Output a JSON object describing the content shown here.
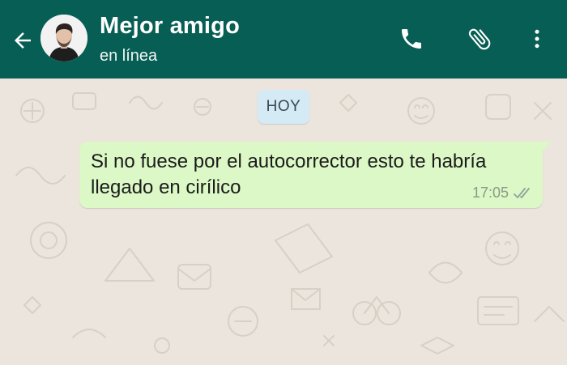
{
  "header": {
    "title": "Mejor amigo",
    "status": "en línea",
    "icons": [
      "back-arrow-icon",
      "avatar",
      "phone-icon",
      "paperclip-icon",
      "more-vert-icon"
    ]
  },
  "chat": {
    "date_chip": "HOY",
    "messages": [
      {
        "direction": "outgoing",
        "text": "Si no fuese por el autocorrector esto te habría llegado en cirílico",
        "time": "17:05",
        "status_icon": "double-check-icon"
      }
    ]
  },
  "colors": {
    "header_bg": "#075e54",
    "chat_bg": "#ece5dd",
    "outgoing_bubble": "#dcf8c6",
    "date_chip_bg": "#d4eaf4"
  }
}
